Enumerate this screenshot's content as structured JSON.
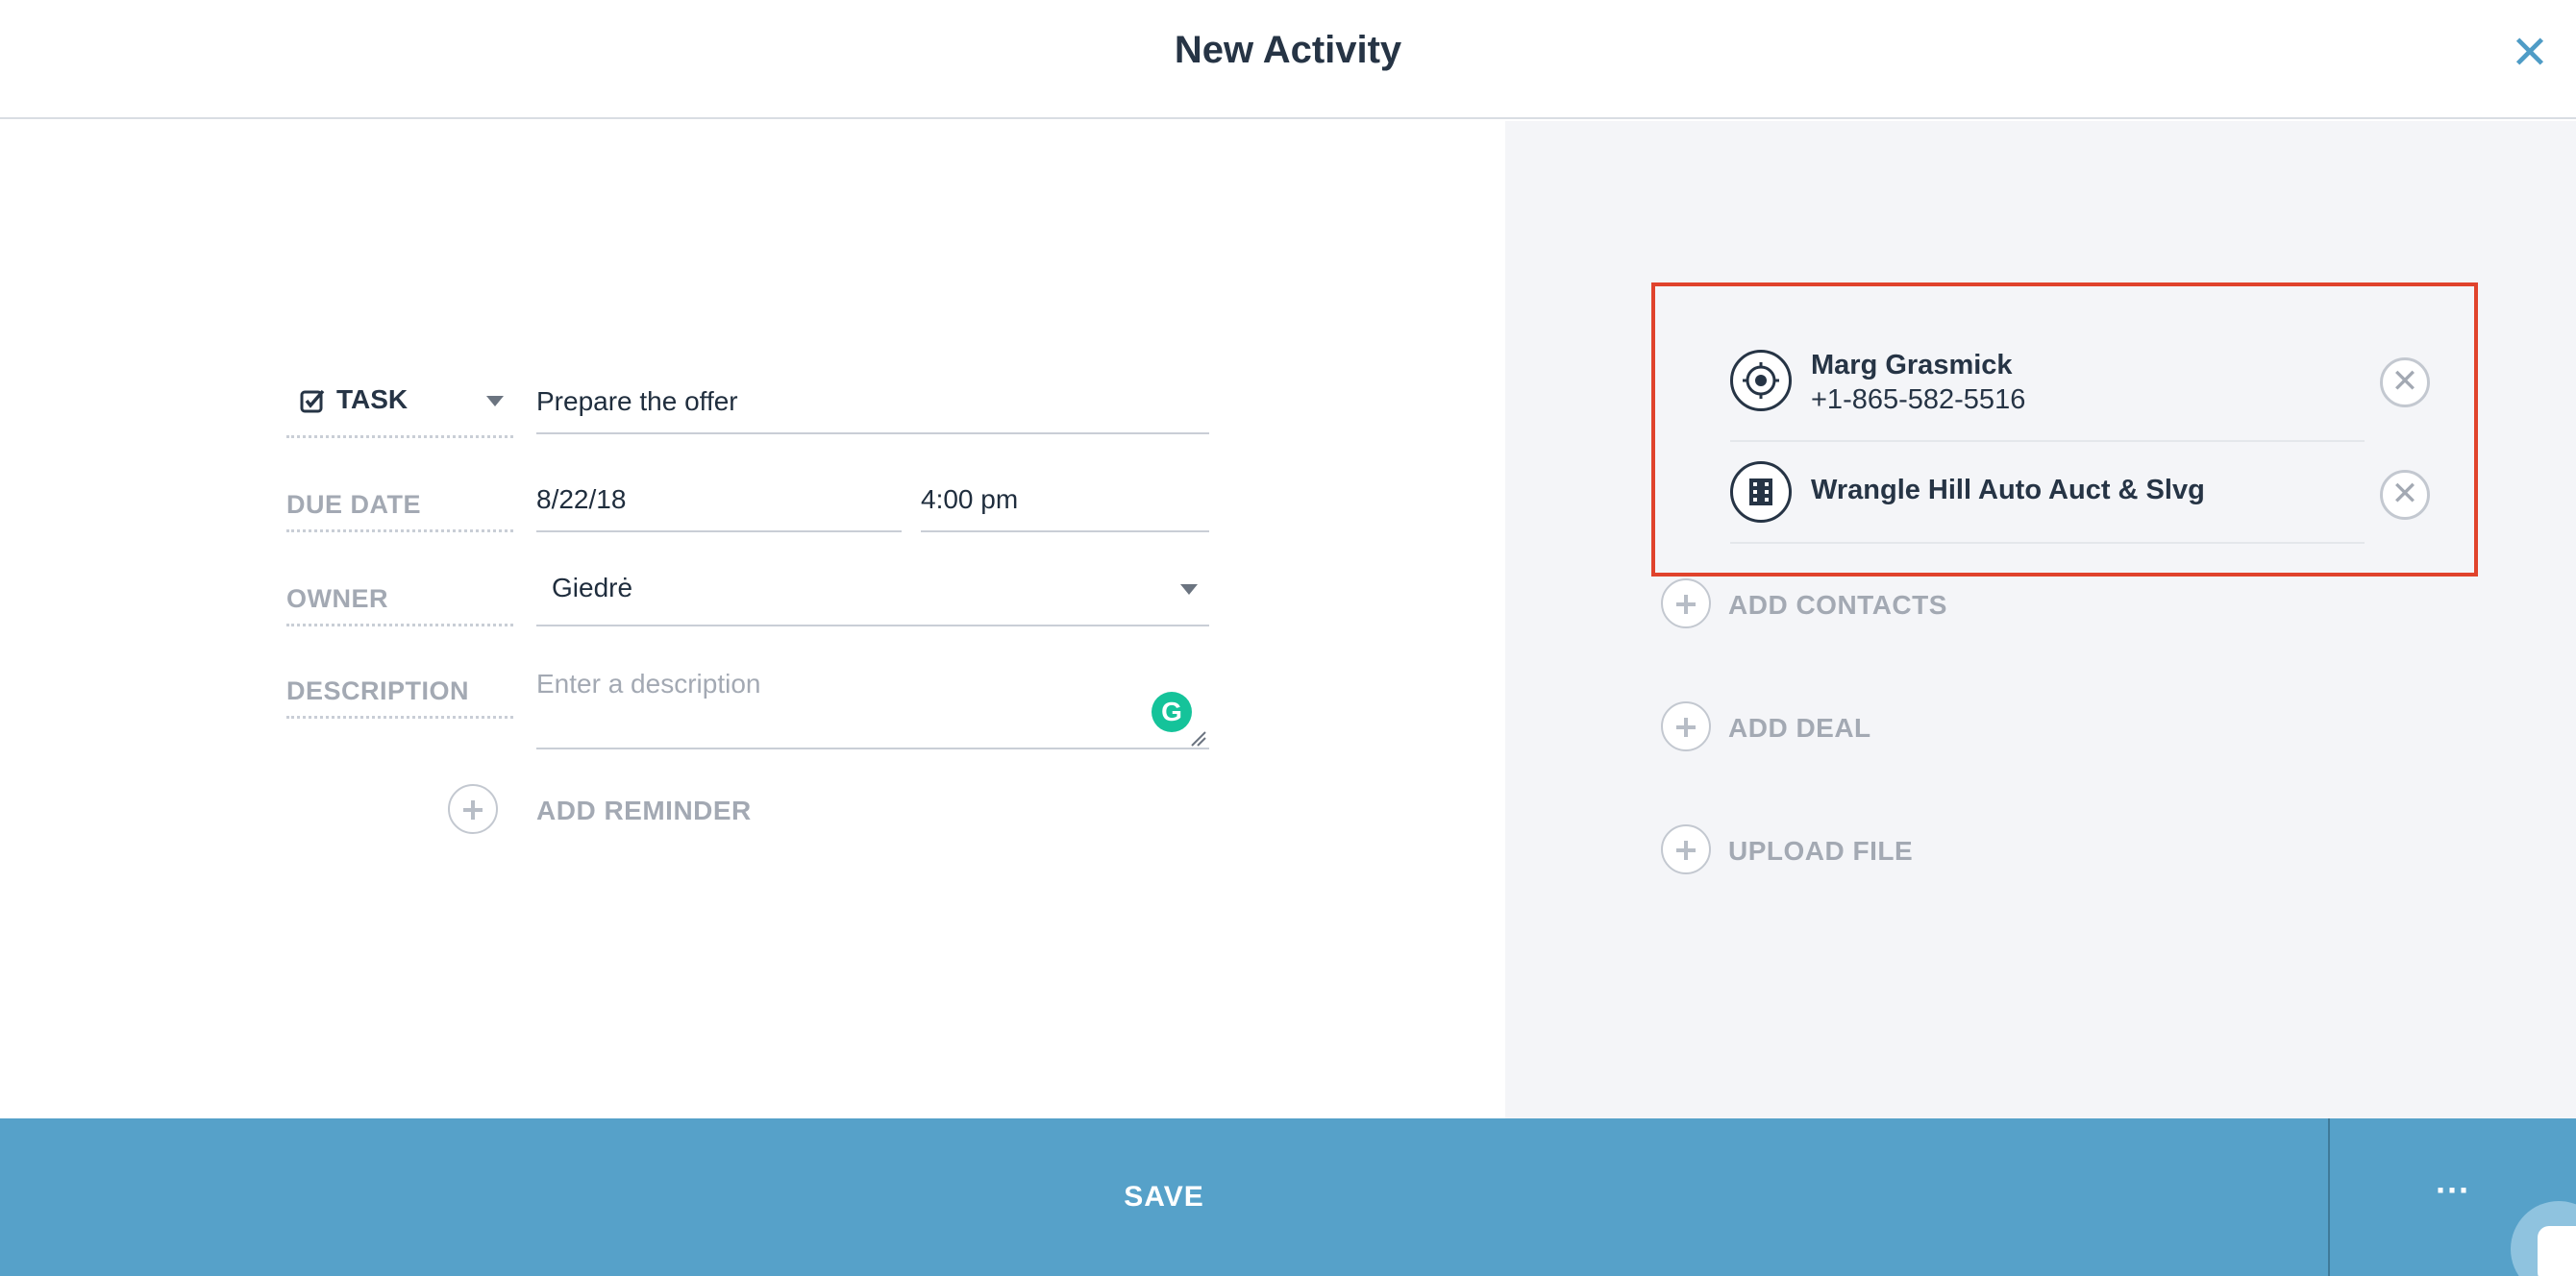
{
  "header": {
    "title": "New Activity",
    "close_icon": "close-icon"
  },
  "form": {
    "type": {
      "label": "TASK",
      "icon": "checkbox-checked-icon"
    },
    "title_value": "Prepare the offer",
    "due_date": {
      "label": "DUE DATE",
      "date": "8/22/18",
      "time": "4:00 pm"
    },
    "owner": {
      "label": "OWNER",
      "value": "Giedrė"
    },
    "description": {
      "label": "DESCRIPTION",
      "placeholder": "Enter a description"
    },
    "add_reminder": "ADD REMINDER"
  },
  "linked": {
    "contact": {
      "name": "Marg Grasmick",
      "phone": "+1-865-582-5516",
      "icon": "target-icon"
    },
    "company": {
      "name": "Wrangle Hill Auto Auct & Slvg",
      "icon": "building-icon"
    }
  },
  "actions": {
    "add_contacts": "ADD CONTACTS",
    "add_deal": "ADD DEAL",
    "upload_file": "UPLOAD FILE"
  },
  "footer": {
    "save_label": "SAVE",
    "more_label": "···"
  },
  "colors": {
    "accent": "#56a1c9",
    "highlight": "#e0432c",
    "grammarly": "#15c39a"
  }
}
